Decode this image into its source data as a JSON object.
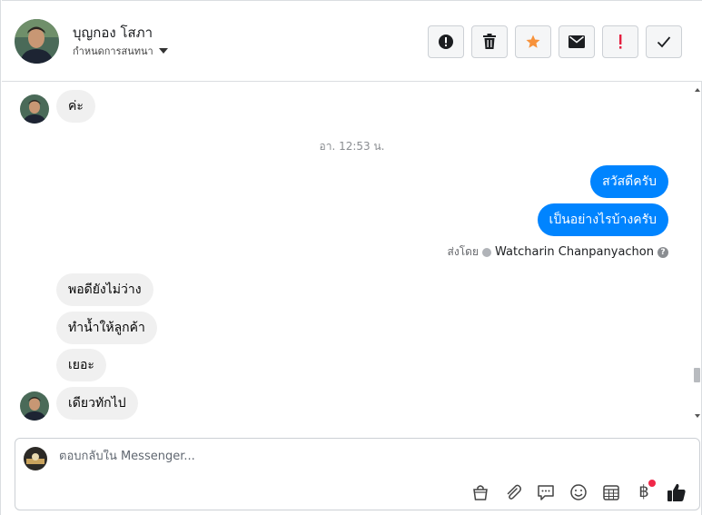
{
  "header": {
    "contact_name": "บุญกอง โสภา",
    "assign_label": "กำหนดการสนทนา",
    "toolbar": [
      {
        "icon": "exclamation-circle-icon"
      },
      {
        "icon": "trash-icon"
      },
      {
        "icon": "star-icon"
      },
      {
        "icon": "envelope-icon"
      },
      {
        "icon": "red-exclamation-icon"
      },
      {
        "icon": "checkmark-icon"
      }
    ]
  },
  "conversation": {
    "timestamp": "อา. 12:53 น.",
    "messages": [
      {
        "direction": "in",
        "text": "ค่ะ"
      },
      {
        "direction": "out",
        "text": "สวัสดีครับ"
      },
      {
        "direction": "out",
        "text": "เป็นอย่างไรบ้างครับ"
      },
      {
        "direction": "in",
        "text": "พอดียังไม่ว่าง"
      },
      {
        "direction": "in",
        "text": "ทำน้ำให้ลูกค้า"
      },
      {
        "direction": "in",
        "text": "เยอะ"
      },
      {
        "direction": "in",
        "text": "เดียวทักไป"
      }
    ],
    "sent_by_label": "ส่งโดย",
    "sent_by_agent": "Watcharin Chanpanyachon",
    "help_glyph": "?"
  },
  "composer": {
    "placeholder": "ตอบกลับใน Messenger...",
    "baht_glyph": "฿",
    "actions": [
      "shopping-bag-icon",
      "paperclip-icon",
      "saved-reply-icon",
      "emoji-icon",
      "appointment-icon",
      "payment-icon",
      "like-icon"
    ],
    "colors": {
      "accent": "#0084ff",
      "notification": "#f02849",
      "star": "#f7923b",
      "alert": "#e41e3f"
    }
  }
}
